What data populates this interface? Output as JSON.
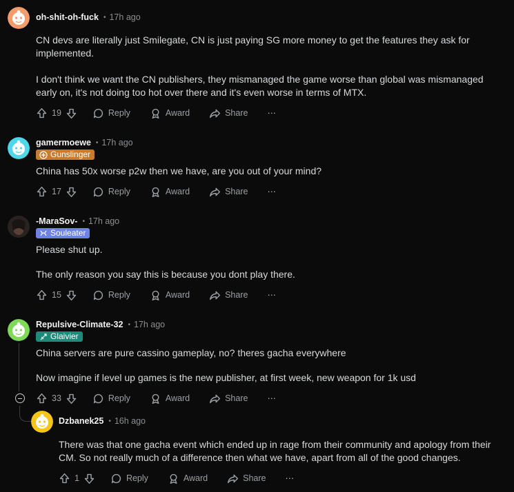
{
  "comments": [
    {
      "username": "oh-shit-oh-fuck",
      "time": "17h ago",
      "paragraphs": [
        "CN devs are literally just Smilegate, CN is just paying SG more money to get the features they ask for implemented.",
        "I don't think we want the CN publishers, they mismanaged the game worse than global was mismanaged early on, it's not doing too hot over there and it's even worse in terms of MTX."
      ],
      "votes": "19"
    },
    {
      "username": "gamermoewe",
      "time": "17h ago",
      "flair": "Gunslinger",
      "flair_color": "#c97a2a",
      "paragraphs": [
        "China has 50x worse p2w then we have, are you out of your mind?"
      ],
      "votes": "17"
    },
    {
      "username": "-MaraSov-",
      "time": "17h ago",
      "flair": "Souleater",
      "flair_color": "#6f83e6",
      "paragraphs": [
        "Please shut up.",
        "The only reason you say this is because you dont play there."
      ],
      "votes": "15"
    },
    {
      "username": "Repulsive-Climate-32",
      "time": "17h ago",
      "flair": "Glaivier",
      "flair_color": "#1f8a7a",
      "paragraphs": [
        "China servers are pure cassino gameplay, no? theres gacha everywhere",
        "Now imagine if level up games is the new publisher, at first week, new weapon for 1k usd"
      ],
      "votes": "33"
    },
    {
      "username": "Dzbanek25",
      "time": "16h ago",
      "paragraphs": [
        "There was that one gacha event which ended up in rage from their community and apology from their CM. So not really much of a difference then what we have, apart from all of the good changes."
      ],
      "votes": "1"
    }
  ],
  "actions": {
    "reply": "Reply",
    "award": "Award",
    "share": "Share",
    "more": "···"
  },
  "dot": "•"
}
